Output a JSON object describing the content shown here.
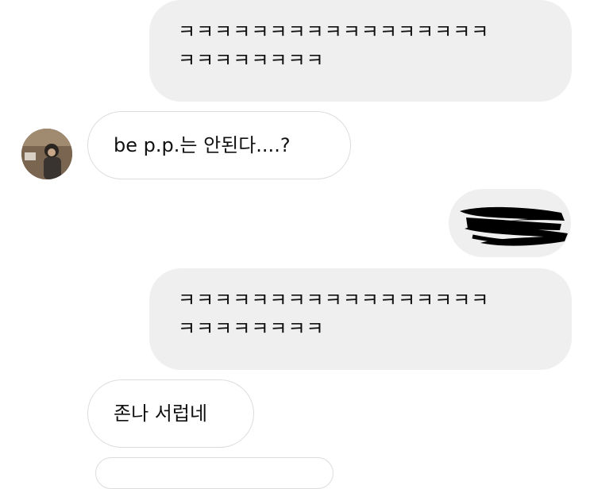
{
  "messages": [
    {
      "sender": "me",
      "text": "ㅋㅋㅋㅋㅋㅋㅋㅋㅋㅋㅋㅋㅋㅋㅋㅋㅋ\nㅋㅋㅋㅋㅋㅋㅋㅋ"
    },
    {
      "sender": "other",
      "text": "be p.p.는 안된다....?"
    },
    {
      "sender": "me",
      "type": "redacted-image"
    },
    {
      "sender": "me",
      "text": "ㅋㅋㅋㅋㅋㅋㅋㅋㅋㅋㅋㅋㅋㅋㅋㅋㅋ\nㅋㅋㅋㅋㅋㅋㅋㅋ"
    },
    {
      "sender": "other",
      "text": "존나 서럽네"
    }
  ],
  "colors": {
    "sent_bubble": "#efefef",
    "received_border": "#dcdcdc",
    "text": "#111111"
  }
}
